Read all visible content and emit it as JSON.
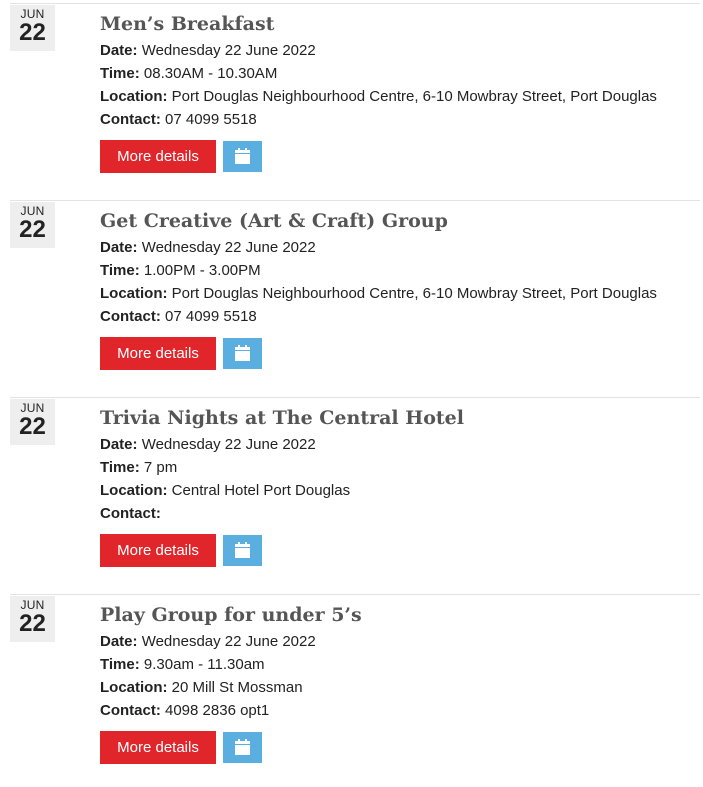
{
  "labels": {
    "date": "Date:",
    "time": "Time:",
    "location": "Location:",
    "contact": "Contact:",
    "more_details": "More details"
  },
  "events": [
    {
      "month": "JUN",
      "day": "22",
      "title": "Men’s Breakfast",
      "date": "Wednesday 22 June 2022",
      "time": "08.30AM - 10.30AM",
      "location": "Port Douglas Neighbourhood Centre, 6-10 Mowbray Street, Port Douglas",
      "contact": "07 4099 5518",
      "calendar_icon": "calendar-icon"
    },
    {
      "month": "JUN",
      "day": "22",
      "title": "Get Creative (Art & Craft) Group",
      "date": "Wednesday 22 June 2022",
      "time": "1.00PM - 3.00PM",
      "location": "Port Douglas Neighbourhood Centre, 6-10 Mowbray Street, Port Douglas",
      "contact": "07 4099 5518",
      "calendar_icon": "calendar-icon"
    },
    {
      "month": "JUN",
      "day": "22",
      "title": "Trivia Nights at The Central Hotel",
      "date": "Wednesday 22 June 2022",
      "time": "7 pm",
      "location": "Central Hotel Port Douglas",
      "contact": "",
      "calendar_icon": "calendar-icon"
    },
    {
      "month": "JUN",
      "day": "22",
      "title": "Play Group for under 5’s",
      "date": "Wednesday 22 June 2022",
      "time": "9.30am - 11.30am",
      "location": "20 Mill St Mossman",
      "contact": "4098 2836 opt1",
      "calendar_icon": "calendar-icon"
    }
  ],
  "colors": {
    "primary_button": "#e0262b",
    "calendar_button": "#5aaee0",
    "title_text": "#555555",
    "date_badge_bg": "#eeeeee"
  }
}
